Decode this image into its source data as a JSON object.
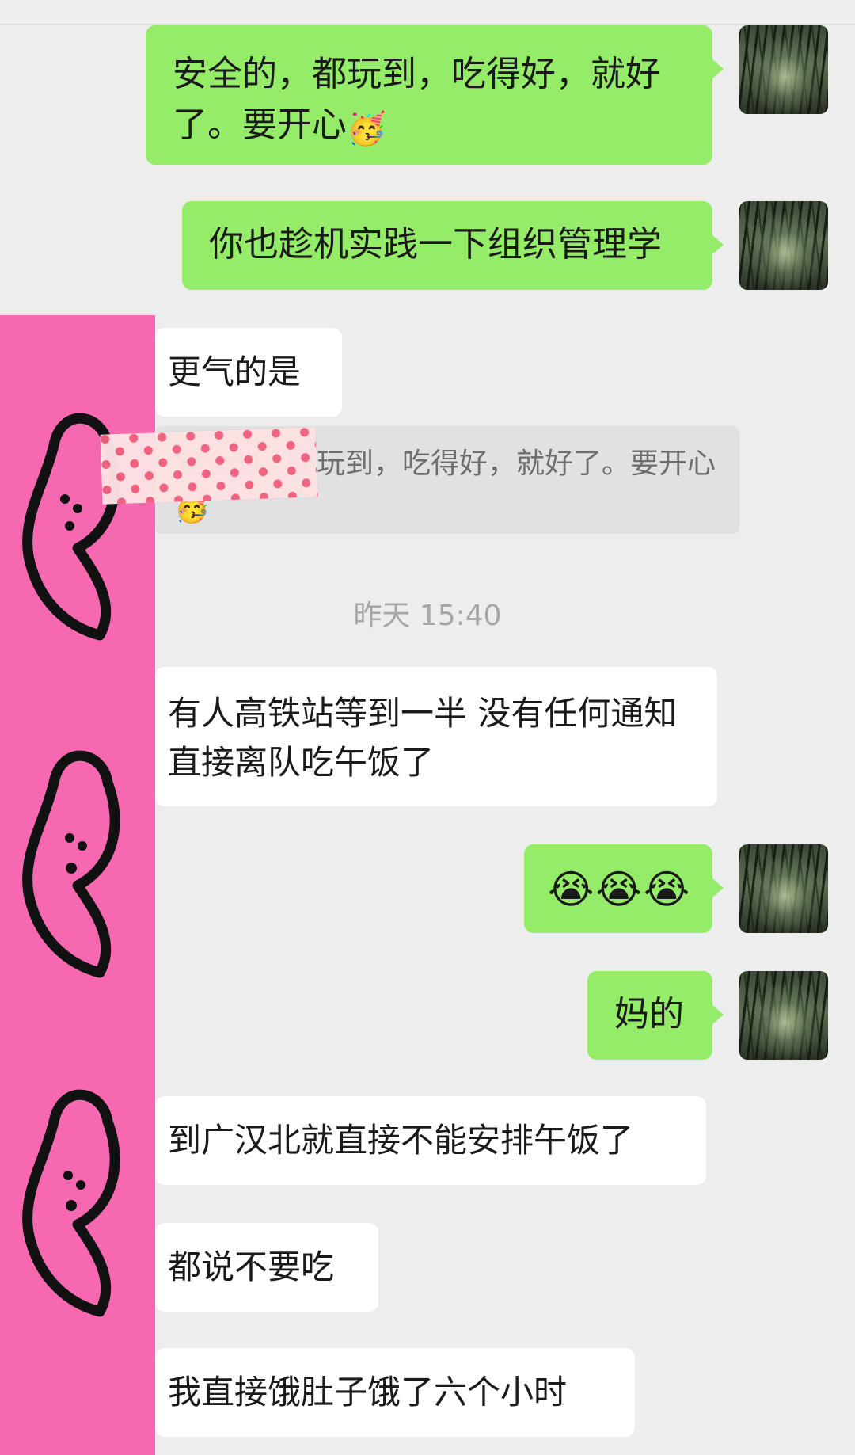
{
  "messages": [
    {
      "text": "安全的，都玩到，吃得好，就好了。要开心",
      "emoji": "🥳"
    },
    {
      "text": "你也趁机实践一下组织管理学"
    },
    {
      "text": "更气的是"
    },
    {
      "quote_text": "安全的，都玩到，吃得好，就好了。要开心",
      "quote_emoji": "🥳"
    },
    {
      "timestamp": "昨天 15:40"
    },
    {
      "text": "有人高铁站等到一半 没有任何通知直接离队吃午饭了"
    },
    {
      "emoji": "😭😭😭"
    },
    {
      "text": "妈的"
    },
    {
      "text": "到广汉北就直接不能安排午饭了"
    },
    {
      "text": "都说不要吃"
    },
    {
      "text": "我直接饿肚子饿了六个小时"
    }
  ],
  "icons": {
    "avatar": "bamboo-forest-avatar-image",
    "sticker": "heart-face-doodle-sticker",
    "tape": "pink-heart-washi-tape"
  },
  "colors": {
    "background": "#ededed",
    "outgoing_bubble": "#95ec69",
    "incoming_bubble": "#ffffff",
    "sticker_panel": "#f669b1"
  }
}
